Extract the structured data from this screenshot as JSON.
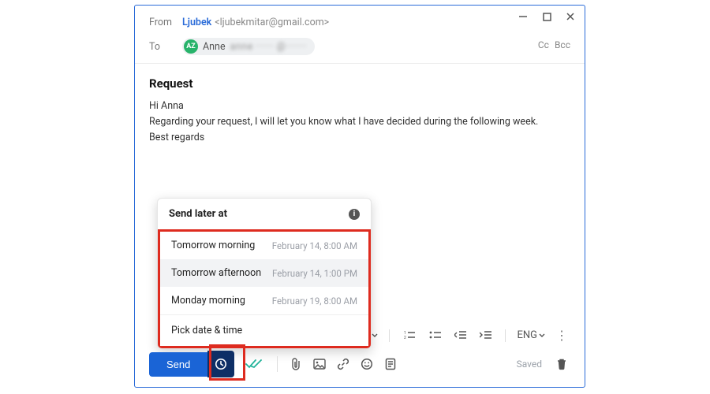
{
  "header": {
    "from_label": "From",
    "from_name": "Ljubek",
    "from_email": "<ljubekmitar@gmail.com>",
    "to_label": "To",
    "to_initials": "AZ",
    "to_name": "Anne",
    "to_blur": "anne ······ @·······",
    "cc": "Cc",
    "bcc": "Bcc"
  },
  "mail": {
    "subject": "Request",
    "body": [
      "Hi Anna",
      "Regarding your request, I will let you know what I have decided during the following week.",
      "Best regards"
    ]
  },
  "popup": {
    "title": "Send later at",
    "options": [
      {
        "label": "Tomorrow morning",
        "time": "February 14, 8:00 AM"
      },
      {
        "label": "Tomorrow afternoon",
        "time": "February 14, 1:00 PM"
      },
      {
        "label": "Monday morning",
        "time": "February 19, 8:00 AM"
      }
    ],
    "pick": "Pick date & time"
  },
  "toolbar": {
    "send": "Send",
    "lang": "ENG",
    "saved": "Saved"
  }
}
